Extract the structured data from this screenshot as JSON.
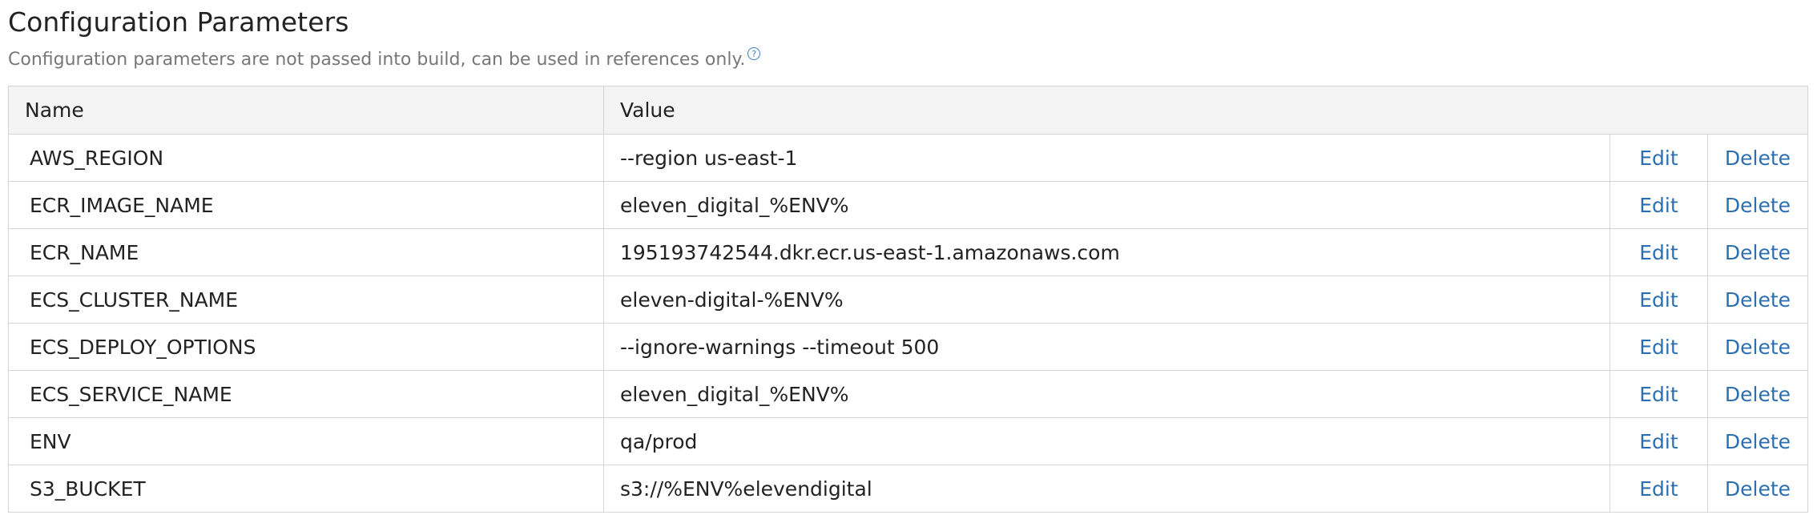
{
  "section": {
    "title": "Configuration Parameters",
    "subtitle": "Configuration parameters are not passed into build, can be used in references only.",
    "help_icon": "question-circle-icon"
  },
  "table": {
    "headers": {
      "name": "Name",
      "value": "Value"
    },
    "edit_label": "Edit",
    "delete_label": "Delete",
    "rows": [
      {
        "name": "AWS_REGION",
        "value": "--region us-east-1"
      },
      {
        "name": "ECR_IMAGE_NAME",
        "value": "eleven_digital_%ENV%"
      },
      {
        "name": "ECR_NAME",
        "value": "195193742544.dkr.ecr.us-east-1.amazonaws.com"
      },
      {
        "name": "ECS_CLUSTER_NAME",
        "value": "eleven-digital-%ENV%"
      },
      {
        "name": "ECS_DEPLOY_OPTIONS",
        "value": "--ignore-warnings --timeout 500"
      },
      {
        "name": "ECS_SERVICE_NAME",
        "value": "eleven_digital_%ENV%"
      },
      {
        "name": "ENV",
        "value": "qa/prod"
      },
      {
        "name": "S3_BUCKET",
        "value": "s3://%ENV%elevendigital"
      }
    ]
  },
  "colors": {
    "link": "#2c6fb0",
    "header_bg": "#f4f4f4",
    "border": "#d4d4d4",
    "subtitle": "#777777"
  }
}
